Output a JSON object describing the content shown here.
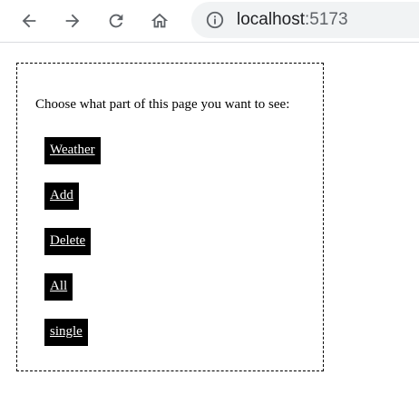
{
  "browser": {
    "url_host": "localhost",
    "url_port": ":5173",
    "icons": {
      "back": "arrow-left-icon",
      "forward": "arrow-right-icon",
      "reload": "reload-icon",
      "home": "home-icon",
      "info": "info-icon"
    }
  },
  "page": {
    "prompt": "Choose what part of this page you want to see:",
    "links": [
      {
        "label": "Weather"
      },
      {
        "label": "Add"
      },
      {
        "label": "Delete"
      },
      {
        "label": "All"
      },
      {
        "label": "single"
      }
    ]
  },
  "colors": {
    "link_background": "#000000",
    "link_text": "#ffffff",
    "omnibox_background": "#f1f3f4"
  }
}
